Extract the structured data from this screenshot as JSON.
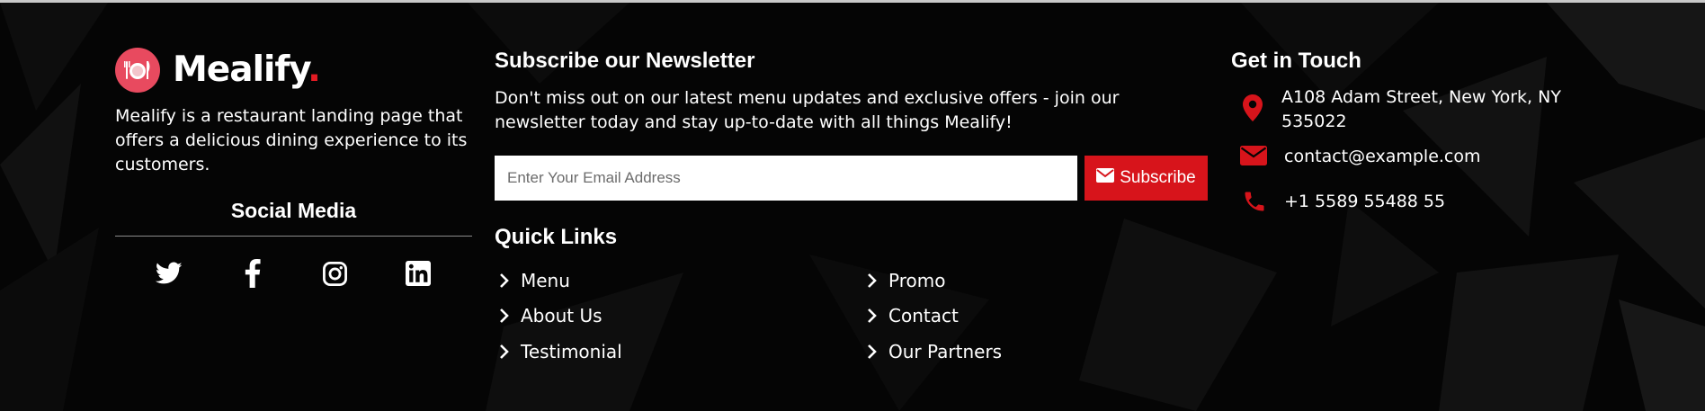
{
  "brand": {
    "name": "Mealify",
    "dot": ".",
    "description": "Mealify is a restaurant landing page that offers a delicious dining experience to its customers.",
    "accent_color": "#e31b23",
    "logo_icon": "plate-cutlery-icon"
  },
  "social": {
    "title": "Social Media",
    "icons": [
      "twitter-icon",
      "facebook-icon",
      "instagram-icon",
      "linkedin-icon"
    ]
  },
  "newsletter": {
    "title": "Subscribe our Newsletter",
    "description": "Don't miss out on our latest menu updates and exclusive offers - join our newsletter today and stay up-to-date with all things Mealify!",
    "email_placeholder": "Enter Your Email Address",
    "email_value": "",
    "subscribe_label": "Subscribe",
    "subscribe_icon": "envelope-icon"
  },
  "quick_links": {
    "title": "Quick Links",
    "items": [
      "Menu",
      "About Us",
      "Testimonial",
      "Promo",
      "Contact",
      "Our Partners"
    ]
  },
  "contact": {
    "title": "Get in Touch",
    "address_line1": "A108 Adam Street, New York, NY",
    "address_line2": "535022",
    "email": "contact@example.com",
    "phone": "+1 5589 55488 55",
    "icons": [
      "map-marker-icon",
      "envelope-icon",
      "phone-icon"
    ]
  }
}
